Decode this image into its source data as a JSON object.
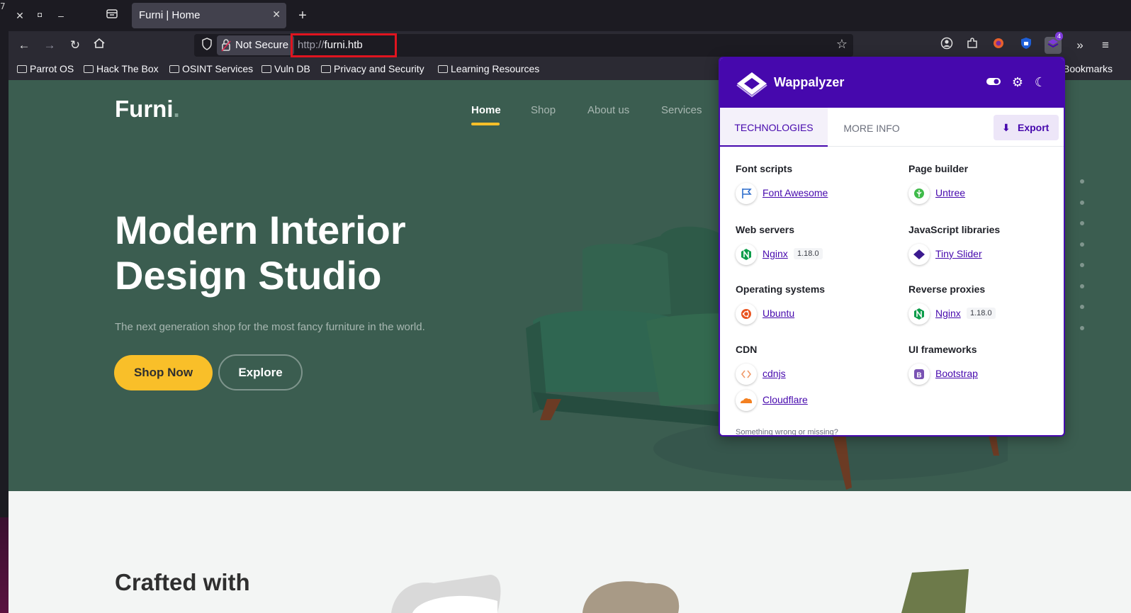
{
  "left_strip": {
    "number": "7"
  },
  "browser": {
    "tab": {
      "title": "Furni | Home"
    },
    "security_label": "Not Secure",
    "url_scheme": "http://",
    "url_host": "furni.htb",
    "extension_badge": "4",
    "bookmarks": [
      "Parrot OS",
      "Hack The Box",
      "OSINT Services",
      "Vuln DB",
      "Privacy and Security",
      "Learning Resources"
    ],
    "bookmarks_overflow": "Bookmarks"
  },
  "site": {
    "logo": "Furni",
    "logo_dot": ".",
    "nav": [
      "Home",
      "Shop",
      "About us",
      "Services"
    ],
    "hero_title_line1": "Modern Interior",
    "hero_title_line2": "Design Studio",
    "hero_subtitle": "The next generation shop for the most fancy furniture in the world.",
    "shop_now": "Shop Now",
    "explore": "Explore",
    "crafted": "Crafted with",
    "accent_color": "#f9bf29",
    "hero_color": "#3b5d50"
  },
  "wappalyzer": {
    "title": "Wappalyzer",
    "tabs": [
      "TECHNOLOGIES",
      "MORE INFO"
    ],
    "export": "Export",
    "brand_color": "#4608ad",
    "categories": [
      {
        "name": "Font scripts",
        "techs": [
          {
            "name": "Font Awesome",
            "icon": "font-awesome-icon"
          }
        ]
      },
      {
        "name": "Page builder",
        "techs": [
          {
            "name": "Untree",
            "icon": "untree-icon"
          }
        ]
      },
      {
        "name": "Web servers",
        "techs": [
          {
            "name": "Nginx",
            "version": "1.18.0",
            "icon": "nginx-icon"
          }
        ]
      },
      {
        "name": "JavaScript libraries",
        "techs": [
          {
            "name": "Tiny Slider",
            "icon": "tiny-slider-icon"
          }
        ]
      },
      {
        "name": "Operating systems",
        "techs": [
          {
            "name": "Ubuntu",
            "icon": "ubuntu-icon"
          }
        ]
      },
      {
        "name": "Reverse proxies",
        "techs": [
          {
            "name": "Nginx",
            "version": "1.18.0",
            "icon": "nginx-icon"
          }
        ]
      },
      {
        "name": "CDN",
        "techs": [
          {
            "name": "cdnjs",
            "icon": "cdnjs-icon"
          },
          {
            "name": "Cloudflare",
            "icon": "cloudflare-icon"
          }
        ]
      },
      {
        "name": "UI frameworks",
        "techs": [
          {
            "name": "Bootstrap",
            "icon": "bootstrap-icon"
          }
        ]
      }
    ],
    "footer": "Something wrong or missing?"
  }
}
